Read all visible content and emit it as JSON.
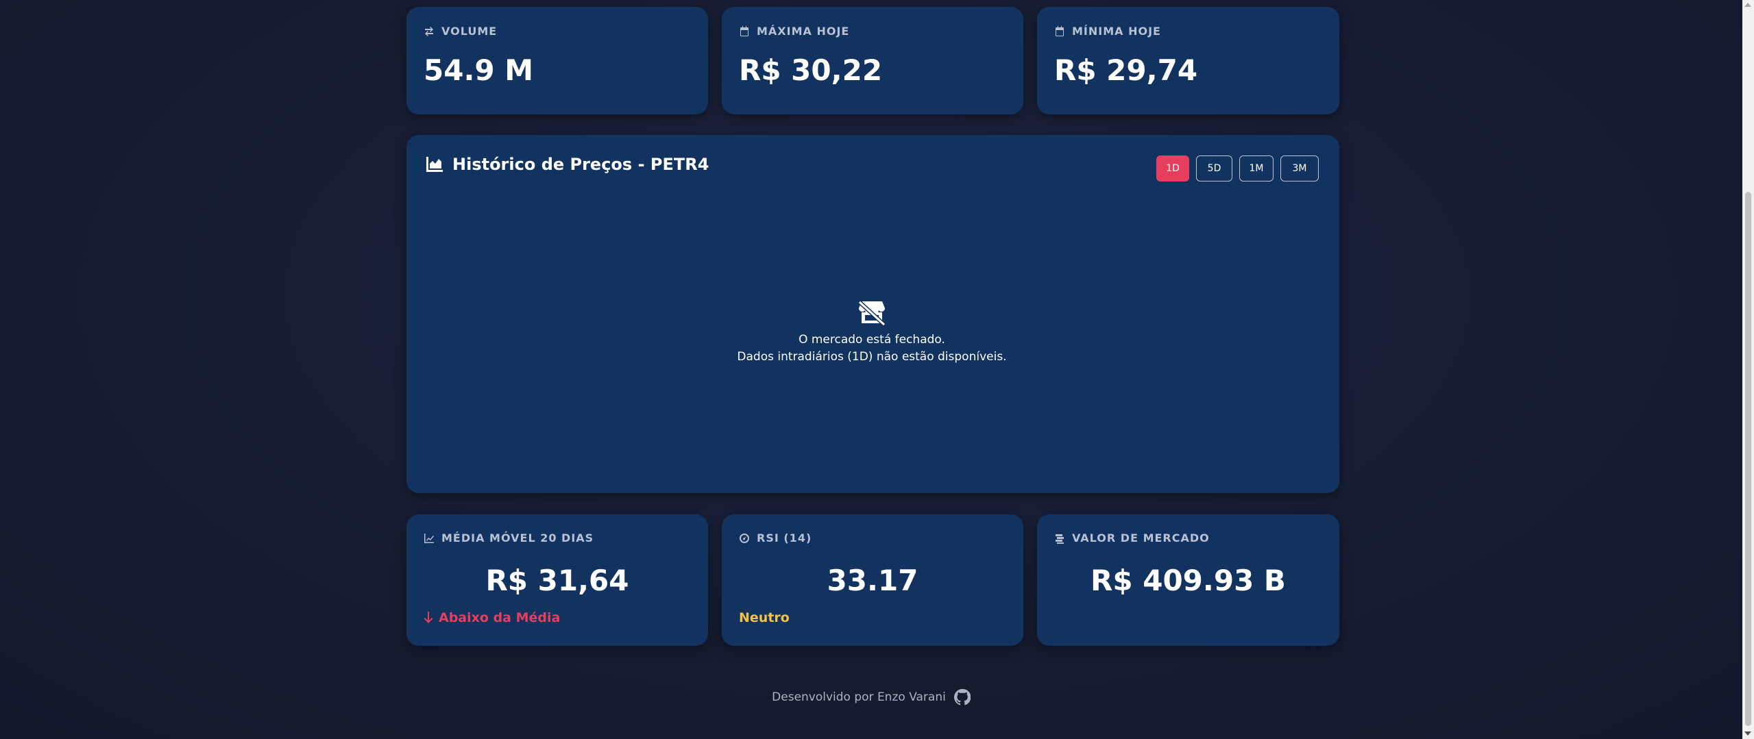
{
  "top_cards": [
    {
      "label": "VOLUME",
      "value": "54.9 M",
      "icon": "exchange-icon"
    },
    {
      "label": "MÁXIMA HOJE",
      "value": "R$ 30,22",
      "icon": "calendar-icon"
    },
    {
      "label": "MÍNIMA HOJE",
      "value": "R$ 29,74",
      "icon": "calendar-icon"
    }
  ],
  "chart": {
    "title": "Histórico de Preços - PETR4",
    "icon": "area-chart-icon",
    "ranges": [
      "1D",
      "5D",
      "1M",
      "3M"
    ],
    "active_range": "1D",
    "closed_icon": "store-slash-icon",
    "closed_line1": "O mercado está fechado.",
    "closed_line2": "Dados intradiários (1D) não estão disponíveis."
  },
  "bottom_cards": [
    {
      "label": "MÉDIA MÓVEL 20 DIAS",
      "value": "R$ 31,64",
      "sub": "Abaixo da Média",
      "sub_color": "#e63e5c",
      "icon": "line-chart-icon"
    },
    {
      "label": "RSI (14)",
      "value": "33.17",
      "sub": "Neutro",
      "sub_color": "#f5c242",
      "icon": "gauge-icon"
    },
    {
      "label": "VALOR DE MERCADO",
      "value": "R$ 409.93 B",
      "sub": "",
      "icon": "coins-icon"
    }
  ],
  "footer": {
    "text": "Desenvolvido por Enzo Varani",
    "icon": "github-icon"
  },
  "colors": {
    "card_bg": "#123260",
    "accent": "#e63e5c",
    "neutral": "#f5c242"
  }
}
